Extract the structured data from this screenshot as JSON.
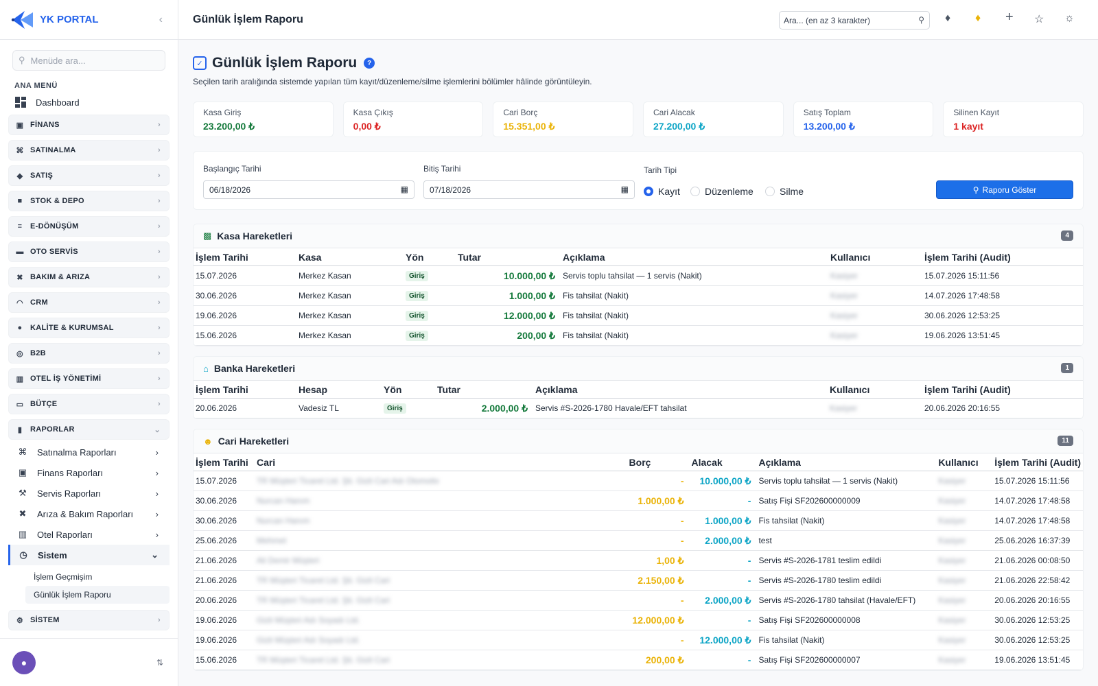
{
  "brand": {
    "name": "YK PORTAL"
  },
  "sidebar": {
    "search_placeholder": "Menüde ara...",
    "section_title": "ANA MENÜ",
    "dashboard": "Dashboard",
    "groups_top": [
      {
        "label": "FİNANS",
        "icon": "finance-icon"
      },
      {
        "label": "SATINALMA",
        "icon": "cart-icon"
      },
      {
        "label": "SATIŞ",
        "icon": "tag-icon"
      },
      {
        "label": "STOK & DEPO",
        "icon": "box-icon"
      },
      {
        "label": "E-DÖNÜŞÜM",
        "icon": "document-icon"
      },
      {
        "label": "OTO SERVİS",
        "icon": "car-icon"
      },
      {
        "label": "BAKIM & ARIZA",
        "icon": "tools-icon"
      },
      {
        "label": "CRM",
        "icon": "headset-icon"
      },
      {
        "label": "KALİTE & KURUMSAL",
        "icon": "badge-icon"
      },
      {
        "label": "B2B",
        "icon": "globe-icon"
      },
      {
        "label": "OTEL İŞ YÖNETİMİ",
        "icon": "building-icon"
      },
      {
        "label": "BÜTÇE",
        "icon": "wallet-icon"
      }
    ],
    "reports_group": "RAPORLAR",
    "report_items": [
      {
        "label": "Satınalma Raporları",
        "icon": "cart-icon"
      },
      {
        "label": "Finans Raporları",
        "icon": "finance-icon"
      },
      {
        "label": "Servis Raporları",
        "icon": "wrench-icon"
      },
      {
        "label": "Arıza & Bakım Raporları",
        "icon": "tools-icon"
      },
      {
        "label": "Otel Raporları",
        "icon": "building-icon"
      }
    ],
    "system_item": "Sistem",
    "system_leaves": [
      "İşlem Geçmişim",
      "Günlük İşlem Raporu"
    ],
    "system_group": "SİSTEM"
  },
  "topbar": {
    "title": "Günlük İşlem Raporu",
    "search_placeholder": "Ara... (en az 3 karakter)"
  },
  "page": {
    "title": "Günlük İşlem Raporu",
    "description": "Seçilen tarih aralığında sistemde yapılan tüm kayıt/düzenleme/silme işlemlerini bölümler hâlinde görüntüleyin."
  },
  "stats": [
    {
      "label": "Kasa Giriş",
      "value": "23.200,00 ₺",
      "color": "#157a3c"
    },
    {
      "label": "Kasa Çıkış",
      "value": "0,00 ₺",
      "color": "#dc2626"
    },
    {
      "label": "Cari Borç",
      "value": "15.351,00 ₺",
      "color": "#eab308"
    },
    {
      "label": "Cari Alacak",
      "value": "27.200,00 ₺",
      "color": "#0ea5c6"
    },
    {
      "label": "Satış Toplam",
      "value": "13.200,00 ₺",
      "color": "#2563eb"
    },
    {
      "label": "Silinen Kayıt",
      "value": "1 kayıt",
      "color": "#dc2626"
    }
  ],
  "filters": {
    "start_label": "Başlangıç Tarihi",
    "start_value": "06/18/2026",
    "end_label": "Bitiş Tarihi",
    "end_value": "07/18/2026",
    "type_label": "Tarih Tipi",
    "options": [
      "Kayıt",
      "Düzenleme",
      "Silme"
    ],
    "selected": "Kayıt",
    "button": "Raporu Göster"
  },
  "kasa": {
    "title": "Kasa Hareketleri",
    "count": "4",
    "headers": [
      "İşlem Tarihi",
      "Kasa",
      "Yön",
      "Tutar",
      "Açıklama",
      "Kullanıcı",
      "İşlem Tarihi (Audit)"
    ],
    "rows": [
      {
        "date": "15.07.2026",
        "kasa": "Merkez Kasan",
        "dir": "Giriş",
        "amount": "10.000,00 ₺",
        "desc": "Servis toplu tahsilat — 1 servis (Nakit)",
        "user": "Kasiyer",
        "audit": "15.07.2026 15:11:56"
      },
      {
        "date": "30.06.2026",
        "kasa": "Merkez Kasan",
        "dir": "Giriş",
        "amount": "1.000,00 ₺",
        "desc": "Fis tahsilat (Nakit)",
        "user": "Kasiyer",
        "audit": "14.07.2026 17:48:58"
      },
      {
        "date": "19.06.2026",
        "kasa": "Merkez Kasan",
        "dir": "Giriş",
        "amount": "12.000,00 ₺",
        "desc": "Fis tahsilat (Nakit)",
        "user": "Kasiyer",
        "audit": "30.06.2026 12:53:25"
      },
      {
        "date": "15.06.2026",
        "kasa": "Merkez Kasan",
        "dir": "Giriş",
        "amount": "200,00 ₺",
        "desc": "Fis tahsilat (Nakit)",
        "user": "Kasiyer",
        "audit": "19.06.2026 13:51:45"
      }
    ]
  },
  "banka": {
    "title": "Banka Hareketleri",
    "count": "1",
    "headers": [
      "İşlem Tarihi",
      "Hesap",
      "Yön",
      "Tutar",
      "Açıklama",
      "Kullanıcı",
      "İşlem Tarihi (Audit)"
    ],
    "rows": [
      {
        "date": "20.06.2026",
        "hesap": "Vadesiz TL",
        "dir": "Giriş",
        "amount": "2.000,00 ₺",
        "desc": "Servis #S-2026-1780 Havale/EFT tahsilat",
        "user": "Kasiyer",
        "audit": "20.06.2026 20:16:55"
      }
    ]
  },
  "cari": {
    "title": "Cari Hareketleri",
    "count": "11",
    "headers": [
      "İşlem Tarihi",
      "Cari",
      "Borç",
      "Alacak",
      "Açıklama",
      "Kullanıcı",
      "İşlem Tarihi (Audit)"
    ],
    "rows": [
      {
        "date": "15.07.2026",
        "cari": "TR Müşteri Ticaret Ltd. Şti. Gizli Cari Adı Otomotiv",
        "borc": "-",
        "alacak": "10.000,00 ₺",
        "desc": "Servis toplu tahsilat — 1 servis (Nakit)",
        "user": "Kasiyer",
        "audit": "15.07.2026 15:11:56"
      },
      {
        "date": "30.06.2026",
        "cari": "Nurcan Hanım",
        "borc": "1.000,00 ₺",
        "alacak": "-",
        "desc": "Satış Fişi SF202600000009",
        "user": "Kasiyer",
        "audit": "14.07.2026 17:48:58"
      },
      {
        "date": "30.06.2026",
        "cari": "Nurcan Hanım",
        "borc": "-",
        "alacak": "1.000,00 ₺",
        "desc": "Fis tahsilat (Nakit)",
        "user": "Kasiyer",
        "audit": "14.07.2026 17:48:58"
      },
      {
        "date": "25.06.2026",
        "cari": "Mehmet",
        "borc": "-",
        "alacak": "2.000,00 ₺",
        "desc": "test",
        "user": "Kasiyer",
        "audit": "25.06.2026 16:37:39"
      },
      {
        "date": "21.06.2026",
        "cari": "Ali Demir Müşteri",
        "borc": "1,00 ₺",
        "alacak": "-",
        "desc": "Servis #S-2026-1781 teslim edildi",
        "user": "Kasiyer",
        "audit": "21.06.2026 00:08:50"
      },
      {
        "date": "21.06.2026",
        "cari": "TR Müşteri Ticaret Ltd. Şti. Gizli Cari",
        "borc": "2.150,00 ₺",
        "alacak": "-",
        "desc": "Servis #S-2026-1780 teslim edildi",
        "user": "Kasiyer",
        "audit": "21.06.2026 22:58:42"
      },
      {
        "date": "20.06.2026",
        "cari": "TR Müşteri Ticaret Ltd. Şti. Gizli Cari",
        "borc": "-",
        "alacak": "2.000,00 ₺",
        "desc": "Servis #S-2026-1780 tahsilat (Havale/EFT)",
        "user": "Kasiyer",
        "audit": "20.06.2026 20:16:55"
      },
      {
        "date": "19.06.2026",
        "cari": "Gizli Müşteri Adı Soyadı Ltd.",
        "borc": "12.000,00 ₺",
        "alacak": "-",
        "desc": "Satış Fişi SF202600000008",
        "user": "Kasiyer",
        "audit": "30.06.2026 12:53:25"
      },
      {
        "date": "19.06.2026",
        "cari": "Gizli Müşteri Adı Soyadı Ltd.",
        "borc": "-",
        "alacak": "12.000,00 ₺",
        "desc": "Fis tahsilat (Nakit)",
        "user": "Kasiyer",
        "audit": "30.06.2026 12:53:25"
      },
      {
        "date": "15.06.2026",
        "cari": "TR Müşteri Ticaret Ltd. Şti. Gizli Cari",
        "borc": "200,00 ₺",
        "alacak": "-",
        "desc": "Satış Fişi SF202600000007",
        "user": "Kasiyer",
        "audit": "19.06.2026 13:51:45"
      }
    ]
  }
}
